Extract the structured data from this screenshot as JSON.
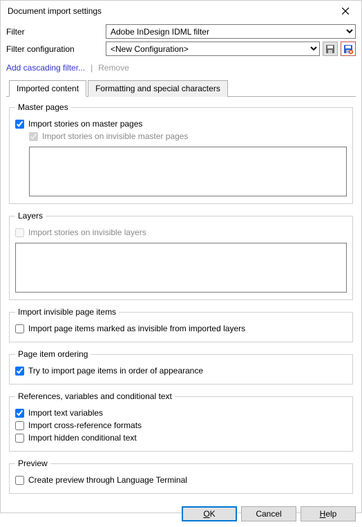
{
  "titlebar": {
    "title": "Document import settings"
  },
  "filter_row": {
    "label": "Filter",
    "selected": "Adobe InDesign IDML filter"
  },
  "config_row": {
    "label": "Filter configuration",
    "selected": "<New Configuration>"
  },
  "links": {
    "add": "Add cascading filter...",
    "remove": "Remove"
  },
  "tabs": {
    "imported": "Imported content",
    "formatting": "Formatting and special characters"
  },
  "master_pages": {
    "legend": "Master pages",
    "import_master": "Import stories on master pages",
    "import_invisible_master": "Import stories on invisible master pages"
  },
  "layers": {
    "legend": "Layers",
    "import_invisible_layers": "Import stories on invisible layers"
  },
  "invisible_items": {
    "legend": "Import invisible page items",
    "import_invisible": "Import page items marked as invisible from imported layers"
  },
  "ordering": {
    "legend": "Page item ordering",
    "try_order": "Try to import page items in order of appearance"
  },
  "references": {
    "legend": "References, variables and conditional text",
    "text_vars": "Import text variables",
    "cross_ref": "Import cross-reference formats",
    "hidden_cond": "Import hidden conditional text"
  },
  "preview": {
    "legend": "Preview",
    "create_preview": "Create preview through Language Terminal"
  },
  "buttons": {
    "ok": "OK",
    "cancel": "Cancel",
    "help": "Help"
  }
}
